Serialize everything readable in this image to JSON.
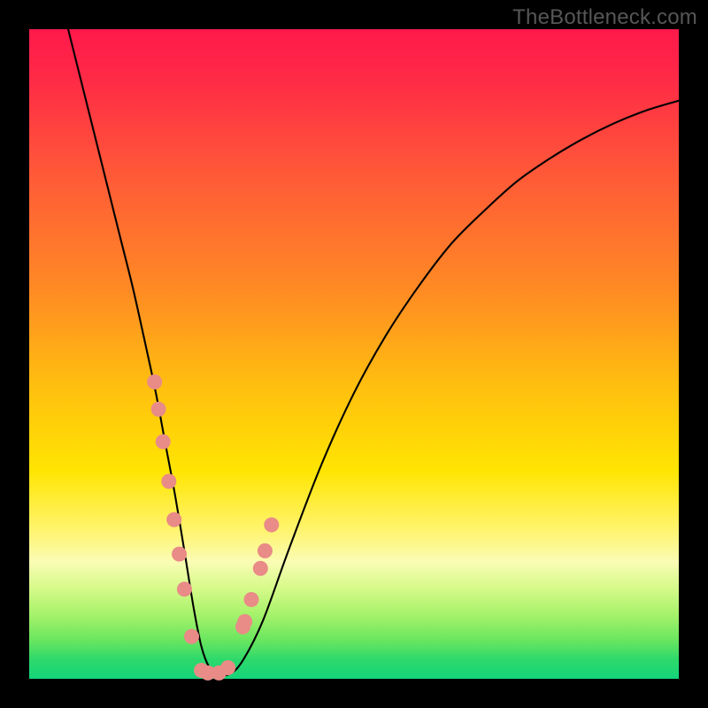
{
  "watermark": "TheBottleneck.com",
  "chart_data": {
    "type": "line",
    "title": "",
    "xlabel": "",
    "ylabel": "",
    "xlim": [
      0,
      100
    ],
    "ylim": [
      0,
      100
    ],
    "curve": {
      "name": "bottleneck-curve",
      "color": "#000000",
      "stroke_width": 2.1,
      "x": [
        6,
        8,
        10,
        12,
        14,
        16,
        18,
        19.5,
        21,
        22.5,
        24,
        25.3,
        26.5,
        27.7,
        29,
        31,
        33,
        36,
        40,
        45,
        50,
        55,
        60,
        65,
        70,
        75,
        80,
        85,
        90,
        95,
        100
      ],
      "y": [
        100,
        92,
        84,
        76,
        68,
        60,
        51,
        44,
        36,
        28,
        19,
        11,
        5,
        1.8,
        0.6,
        0.8,
        3,
        9,
        20,
        33,
        44,
        53,
        60.5,
        67,
        72,
        76.5,
        80,
        83,
        85.5,
        87.5,
        89
      ]
    },
    "highlight_points": {
      "name": "highlight-dots",
      "color": "#e98b87",
      "radius": 8.5,
      "x": [
        19.3,
        19.9,
        20.6,
        21.5,
        22.3,
        23.1,
        23.9,
        25.0,
        26.5,
        27.5,
        29.2,
        30.6,
        32.9,
        33.2,
        34.2,
        35.6,
        36.3,
        37.3
      ],
      "y": [
        45.7,
        41.5,
        36.5,
        30.4,
        24.5,
        19.2,
        13.8,
        6.5,
        1.3,
        0.9,
        0.9,
        1.7,
        8.0,
        8.8,
        12.2,
        17.0,
        19.7,
        23.7
      ]
    }
  }
}
